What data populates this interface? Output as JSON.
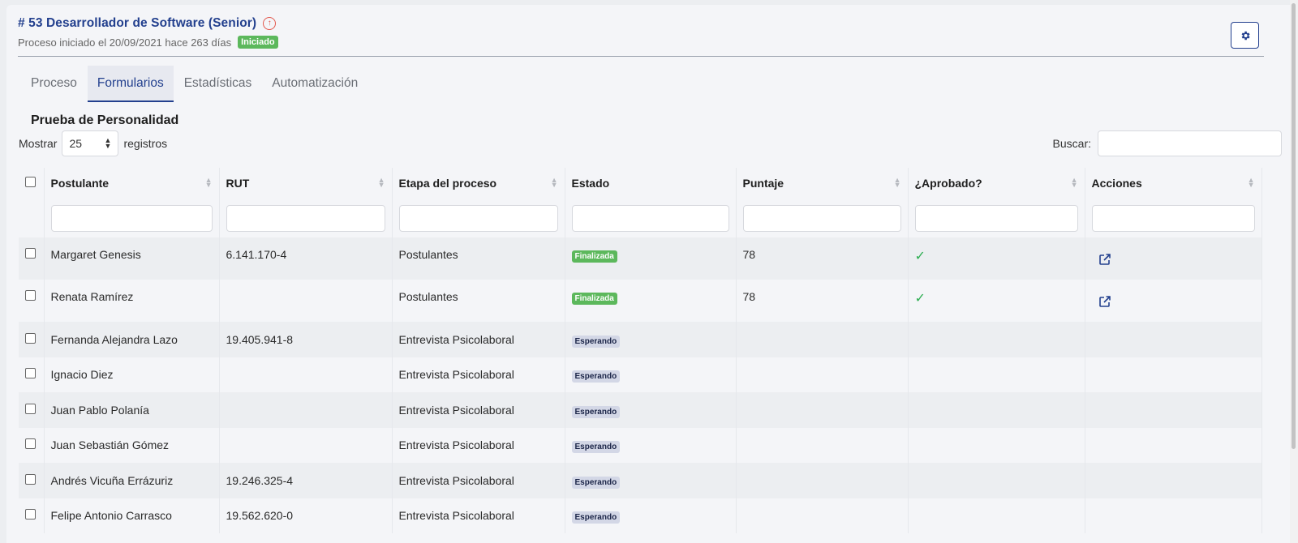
{
  "header": {
    "title": "# 53 Desarrollador de Software (Senior)",
    "up_icon": "arrow-up-circle-icon",
    "subtitle": "Proceso iniciado el 20/09/2021 hace 263 días",
    "status_badge": "Iniciado",
    "settings_icon": "gear-icon"
  },
  "tabs": [
    {
      "label": "Proceso",
      "active": false
    },
    {
      "label": "Formularios",
      "active": true
    },
    {
      "label": "Estadísticas",
      "active": false
    },
    {
      "label": "Automatización",
      "active": false
    }
  ],
  "section": {
    "title": "Prueba de Personalidad"
  },
  "length_control": {
    "prefix": "Mostrar",
    "value": "25",
    "suffix": "registros"
  },
  "search": {
    "label": "Buscar:",
    "value": ""
  },
  "table": {
    "columns": [
      "Postulante",
      "RUT",
      "Etapa del proceso",
      "Estado",
      "Puntaje",
      "¿Aprobado?",
      "Acciones"
    ],
    "rows": [
      {
        "postulante": "Margaret Genesis",
        "rut": "6.141.170-4",
        "etapa": "Postulantes",
        "estado": "Finalizada",
        "puntaje": "78",
        "aprobado": true,
        "accion": true
      },
      {
        "postulante": "Renata Ramírez",
        "rut": "",
        "etapa": "Postulantes",
        "estado": "Finalizada",
        "puntaje": "78",
        "aprobado": true,
        "accion": true
      },
      {
        "postulante": "Fernanda Alejandra Lazo",
        "rut": "19.405.941-8",
        "etapa": "Entrevista Psicolaboral",
        "estado": "Esperando",
        "puntaje": "",
        "aprobado": false,
        "accion": false
      },
      {
        "postulante": "Ignacio Diez",
        "rut": "",
        "etapa": "Entrevista Psicolaboral",
        "estado": "Esperando",
        "puntaje": "",
        "aprobado": false,
        "accion": false
      },
      {
        "postulante": "Juan Pablo Polanía",
        "rut": "",
        "etapa": "Entrevista Psicolaboral",
        "estado": "Esperando",
        "puntaje": "",
        "aprobado": false,
        "accion": false
      },
      {
        "postulante": "Juan Sebastián Gómez",
        "rut": "",
        "etapa": "Entrevista Psicolaboral",
        "estado": "Esperando",
        "puntaje": "",
        "aprobado": false,
        "accion": false
      },
      {
        "postulante": "Andrés Vicuña Errázuriz",
        "rut": "19.246.325-4",
        "etapa": "Entrevista Psicolaboral",
        "estado": "Esperando",
        "puntaje": "",
        "aprobado": false,
        "accion": false
      },
      {
        "postulante": "Felipe Antonio Carrasco",
        "rut": "19.562.620-0",
        "etapa": "Entrevista Psicolaboral",
        "estado": "Esperando",
        "puntaje": "",
        "aprobado": false,
        "accion": false
      }
    ]
  },
  "colors": {
    "primary": "#23408e",
    "success": "#5cb85c",
    "waiting_badge": "#d3d7e6",
    "check": "#2eae52",
    "alert": "#e2574c"
  }
}
